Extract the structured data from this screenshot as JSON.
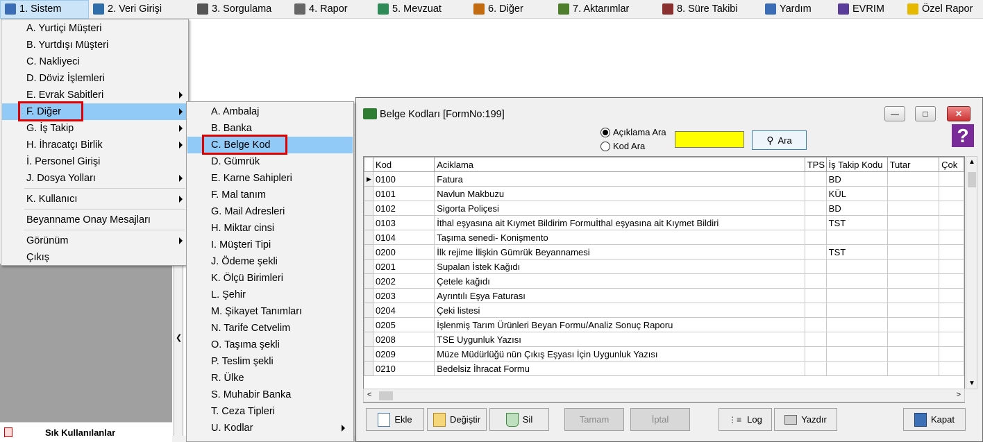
{
  "menubar": {
    "items": [
      {
        "label": "1.  Sistem",
        "icon": "settings-icon",
        "color": "#3a6db5"
      },
      {
        "label": "2.  Veri Girişi",
        "icon": "edit-icon",
        "color": "#2f6ea8"
      },
      {
        "label": "3.  Sorgulama",
        "icon": "search-icon",
        "color": "#555555"
      },
      {
        "label": "4.  Rapor",
        "icon": "printer-icon",
        "color": "#666666"
      },
      {
        "label": "5.  Mevzuat",
        "icon": "books-icon",
        "color": "#2e8b57"
      },
      {
        "label": "6.  Diğer",
        "icon": "globe-icon",
        "color": "#c26b10"
      },
      {
        "label": "7.  Aktarımlar",
        "icon": "transfer-icon",
        "color": "#4f7f2d"
      },
      {
        "label": "8. Süre Takibi",
        "icon": "calendar-icon",
        "color": "#8b3030"
      },
      {
        "label": "Yardım",
        "icon": "help-icon",
        "color": "#3a6db5"
      },
      {
        "label": "EVRIM",
        "icon": "evrim-icon",
        "color": "#5a3d9a"
      },
      {
        "label": "Özel Rapor",
        "icon": "star-icon",
        "color": "#e6b800"
      }
    ]
  },
  "sistem_menu": {
    "items": [
      {
        "label": "A.  Yurtiçi Müşteri"
      },
      {
        "label": "B.  Yurtdışı Müşteri"
      },
      {
        "label": "C.  Nakliyeci"
      },
      {
        "label": "D.  Döviz İşlemleri"
      },
      {
        "label": "E.  Evrak Sabitleri"
      },
      {
        "label": "F.  Diğer"
      },
      {
        "label": "G.  İş Takip"
      },
      {
        "label": "H.  İhracatçı Birlik"
      },
      {
        "label": "İ.   Personel Girişi"
      },
      {
        "label": "J.  Dosya Yolları"
      },
      {
        "label": "K.  Kullanıcı"
      },
      {
        "label": "Beyanname Onay Mesajları"
      },
      {
        "label": "Görünüm"
      },
      {
        "label": "Çıkış"
      }
    ]
  },
  "diger_submenu": {
    "items": [
      {
        "label": "A.  Ambalaj"
      },
      {
        "label": "B.  Banka"
      },
      {
        "label": "C.  Belge Kod"
      },
      {
        "label": "D.  Gümrük"
      },
      {
        "label": "E.  Karne Sahipleri"
      },
      {
        "label": "F.  Mal tanım"
      },
      {
        "label": "G.  Mail Adresleri"
      },
      {
        "label": "H.  Miktar cinsi"
      },
      {
        "label": "I.  Müşteri Tipi"
      },
      {
        "label": "J.  Ödeme şekli"
      },
      {
        "label": "K.  Ölçü Birimleri"
      },
      {
        "label": "L.  Şehir"
      },
      {
        "label": "M.  Şikayet Tanımları"
      },
      {
        "label": "N.  Tarife Cetvelim"
      },
      {
        "label": "O.  Taşıma şekli"
      },
      {
        "label": "P.  Teslim şekli"
      },
      {
        "label": "R.  Ülke"
      },
      {
        "label": "S.  Muhabir Banka"
      },
      {
        "label": "T.  Ceza Tipleri"
      },
      {
        "label": "U. Kodlar"
      }
    ]
  },
  "left_panel": {
    "favorites_label": "Sık Kullanılanlar"
  },
  "dialog": {
    "title": "Belge Kodları [FormNo:199]",
    "radio_aciklama": "Açıklama Ara",
    "radio_kod": "Kod Ara",
    "search_value": "",
    "search_button": "Ara",
    "help_glyph": "?",
    "columns": [
      "Kod",
      "Aciklama",
      "TPS",
      "İş Takip Kodu",
      "Tutar",
      "Çok"
    ],
    "rows": [
      {
        "kod": "0100",
        "aciklama": "Fatura",
        "tps": "",
        "is_takip": "BD",
        "tutar": "",
        "cok": ""
      },
      {
        "kod": "0101",
        "aciklama": "Navlun Makbuzu",
        "tps": "",
        "is_takip": "KÜL",
        "tutar": "",
        "cok": ""
      },
      {
        "kod": "0102",
        "aciklama": "Sigorta Poliçesi",
        "tps": "",
        "is_takip": "BD",
        "tutar": "",
        "cok": ""
      },
      {
        "kod": "0103",
        "aciklama": "İthal eşyasına ait Kıymet Bildirim Formuİthal eşyasına ait Kıymet Bildiri",
        "tps": "",
        "is_takip": "TST",
        "tutar": "",
        "cok": ""
      },
      {
        "kod": "0104",
        "aciklama": "Taşıma senedi- Konişmento",
        "tps": "",
        "is_takip": "",
        "tutar": "",
        "cok": ""
      },
      {
        "kod": "0200",
        "aciklama": "İlk rejime İlişkin Gümrük Beyannamesi",
        "tps": "",
        "is_takip": "TST",
        "tutar": "",
        "cok": ""
      },
      {
        "kod": "0201",
        "aciklama": "Supalan İstek Kağıdı",
        "tps": "",
        "is_takip": "",
        "tutar": "",
        "cok": ""
      },
      {
        "kod": "0202",
        "aciklama": "Çetele kağıdı",
        "tps": "",
        "is_takip": "",
        "tutar": "",
        "cok": ""
      },
      {
        "kod": "0203",
        "aciklama": "Ayrıntılı Eşya Faturası",
        "tps": "",
        "is_takip": "",
        "tutar": "",
        "cok": ""
      },
      {
        "kod": "0204",
        "aciklama": "Çeki listesi",
        "tps": "",
        "is_takip": "",
        "tutar": "",
        "cok": ""
      },
      {
        "kod": "0205",
        "aciklama": "İşlenmiş Tarım Ürünleri Beyan Formu/Analiz Sonuç Raporu",
        "tps": "",
        "is_takip": "",
        "tutar": "",
        "cok": ""
      },
      {
        "kod": "0208",
        "aciklama": "TSE Uygunluk Yazısı",
        "tps": "",
        "is_takip": "",
        "tutar": "",
        "cok": ""
      },
      {
        "kod": "0209",
        "aciklama": "Müze Müdürlüğü nün Çıkış Eşyası İçin Uygunluk Yazısı",
        "tps": "",
        "is_takip": "",
        "tutar": "",
        "cok": ""
      },
      {
        "kod": "0210",
        "aciklama": "Bedelsiz İhracat Formu",
        "tps": "",
        "is_takip": "",
        "tutar": "",
        "cok": ""
      }
    ],
    "buttons": {
      "ekle": "Ekle",
      "degistir": "Değiştir",
      "sil": "Sil",
      "tamam": "Tamam",
      "iptal": "İptal",
      "log": "Log",
      "yazdir": "Yazdır",
      "kapat": "Kapat"
    }
  }
}
